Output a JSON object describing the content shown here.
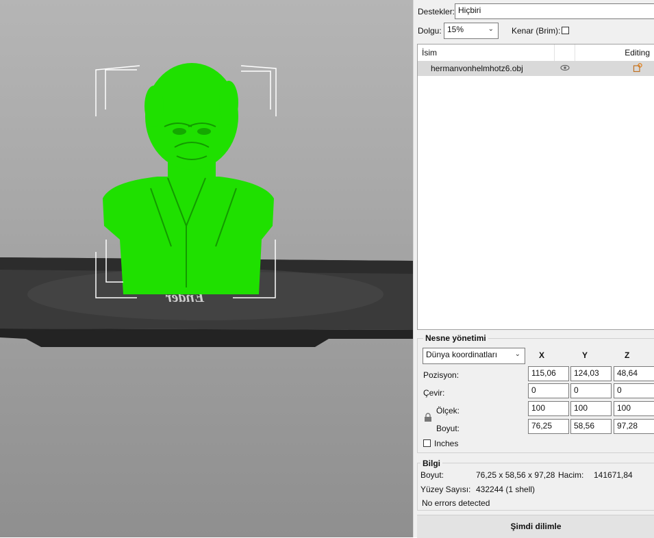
{
  "viewport": {
    "model_color": "#1fe000",
    "plate_text": "Ender"
  },
  "settings": {
    "supports_label": "Destekler:",
    "supports_value": "Hiçbiri",
    "infill_label": "Dolgu:",
    "infill_value": "15%",
    "brim_label": "Kenar (Brim):",
    "brim_checked": false
  },
  "object_list": {
    "col_name": "İsim",
    "col_editing": "Editing",
    "items": [
      {
        "name": "hermanvonhelmhotz6.obj",
        "visible_icon": "eye-icon",
        "edit_icon": "edit-object-icon"
      }
    ]
  },
  "object_management": {
    "title": "Nesne yönetimi",
    "coord_system": "Dünya koordinatları",
    "axes": [
      "X",
      "Y",
      "Z"
    ],
    "position_label": "Pozisyon:",
    "rotate_label": "Çevir:",
    "scale_label": "Ölçek:",
    "size_label": "Boyut:",
    "position": [
      "115,06",
      "124,03",
      "48,64"
    ],
    "rotation": [
      "0",
      "0",
      "0"
    ],
    "scale": [
      "100",
      "100",
      "100"
    ],
    "size": [
      "76,25",
      "58,56",
      "97,28"
    ],
    "inches_label": "Inches",
    "inches_checked": false
  },
  "info": {
    "title": "Bilgi",
    "size_label": "Boyut:",
    "size_value": "76,25 x 58,56 x 97,28",
    "volume_label": "Hacim:",
    "volume_value": "141671,84",
    "faces_label": "Yüzey Sayısı:",
    "faces_value": "432244 (1 shell)",
    "errors": "No errors detected"
  },
  "slice_button_label": "Şimdi dilimle"
}
